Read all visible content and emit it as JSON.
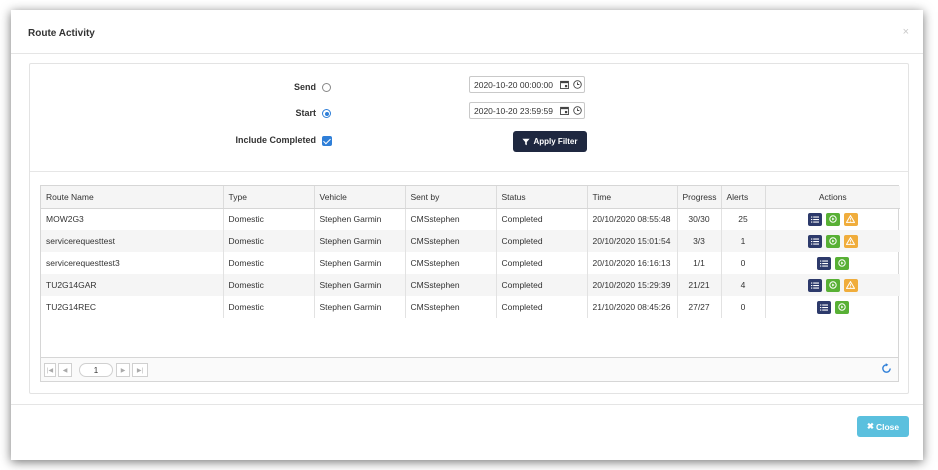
{
  "modal": {
    "title": "Route Activity",
    "close_x": "×"
  },
  "filter": {
    "send_label": "Send",
    "send_value": "2020-10-20 00:00:00",
    "start_label": "Start",
    "start_value": "2020-10-20 23:59:59",
    "include_completed_label": "Include Completed",
    "include_completed_checked": true,
    "selected_mode": "Start",
    "apply_label": "Apply Filter"
  },
  "table": {
    "headers": [
      "Route Name",
      "Type",
      "Vehicle",
      "Sent by",
      "Status",
      "Time",
      "Progress",
      "Alerts",
      "Actions"
    ],
    "rows": [
      [
        "MOW2G3",
        "Domestic",
        "Stephen Garmin",
        "CMSstephen",
        "Completed",
        "20/10/2020 08:55:48",
        "30/30",
        "25"
      ],
      [
        "servicerequesttest",
        "Domestic",
        "Stephen Garmin",
        "CMSstephen",
        "Completed",
        "20/10/2020 15:01:54",
        "3/3",
        "1"
      ],
      [
        "servicerequesttest3",
        "Domestic",
        "Stephen Garmin",
        "CMSstephen",
        "Completed",
        "20/10/2020 16:16:13",
        "1/1",
        "0"
      ],
      [
        "TU2G14GAR",
        "Domestic",
        "Stephen Garmin",
        "CMSstephen",
        "Completed",
        "20/10/2020 15:29:39",
        "21/21",
        "4"
      ],
      [
        "TU2G14REC",
        "Domestic",
        "Stephen Garmin",
        "CMSstephen",
        "Completed",
        "21/10/2020 08:45:26",
        "27/27",
        "0"
      ]
    ],
    "row_actions": [
      [
        "list-icon",
        "play-icon",
        "warning-icon"
      ],
      [
        "list-icon",
        "play-icon",
        "warning-icon"
      ],
      [
        "list-icon",
        "play-icon"
      ],
      [
        "list-icon",
        "play-icon",
        "warning-icon"
      ],
      [
        "list-icon",
        "play-icon"
      ]
    ]
  },
  "pager": {
    "first": "|◀",
    "prev": "◀",
    "page": "1",
    "next": "▶",
    "last": "▶|"
  },
  "footer": {
    "close_label": "Close"
  },
  "colors": {
    "apply": "#1f2840",
    "list": "#2d3a6b",
    "go": "#58b035",
    "warn": "#f0ad3c",
    "close": "#5bc0de",
    "accent": "#2f7fd8"
  }
}
